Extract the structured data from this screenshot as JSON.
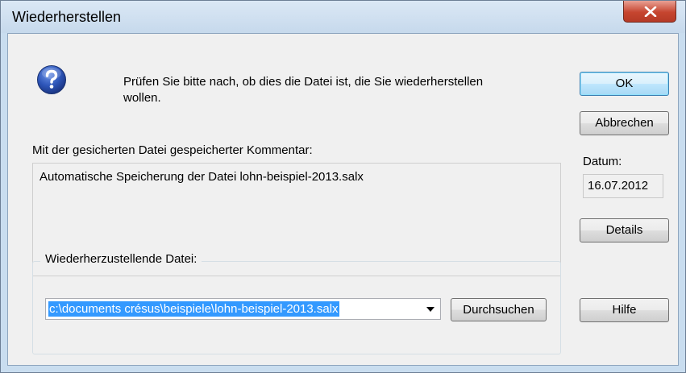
{
  "window": {
    "title": "Wiederherstellen",
    "close_icon": "close-x-icon"
  },
  "message": {
    "icon": "question-icon",
    "text": "Prüfen Sie bitte nach, ob dies die Datei ist, die Sie wiederherstellen wollen."
  },
  "comment": {
    "label": "Mit der gesicherten Datei gespeicherter Kommentar:",
    "text": "Automatische Speicherung der Datei lohn-beispiel-2013.salx"
  },
  "file_group": {
    "label": "Wiederherzustellende Datei:",
    "path_value": "c:\\documents crésus\\beispiele\\lohn-beispiel-2013.salx",
    "browse_label": "Durchsuchen"
  },
  "date": {
    "label": "Datum:",
    "value": "16.07.2012"
  },
  "buttons": {
    "ok": "OK",
    "cancel": "Abbrechen",
    "details": "Details",
    "help": "Hilfe"
  }
}
